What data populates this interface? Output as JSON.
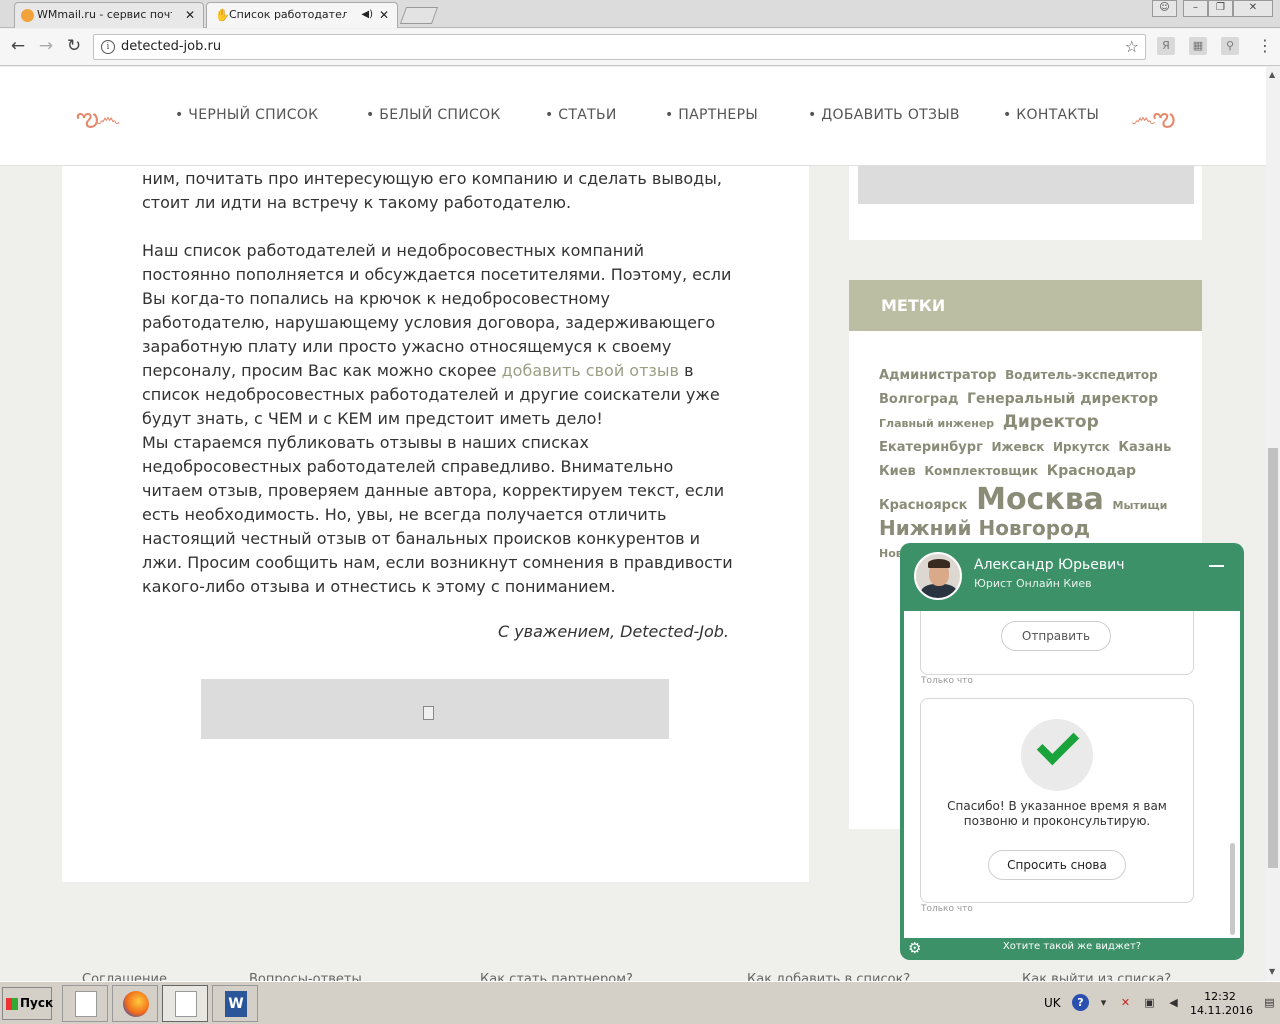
{
  "browser": {
    "tabs": [
      {
        "title": "WMmail.ru - сервис почтов",
        "active": false
      },
      {
        "title": "Список работодателей",
        "active": true
      }
    ],
    "url": "detected-job.ru"
  },
  "site": {
    "menu": [
      "• ЧЕРНЫЙ СПИСОК",
      "• БЕЛЫЙ СПИСОК",
      "• СТАТЬИ",
      "• ПАРТНЕРЫ",
      "• ДОБАВИТЬ ОТЗЫВ",
      "• КОНТАКТЫ"
    ],
    "article": {
      "p1": "ним, почитать про интересующую его компанию и сделать выводы, стоит ли идти на встречу к такому работодателю.",
      "p2_before": "Наш список работодателей и недобросовестных компаний постоянно пополняется и обсуждается посетителями. Поэтому, если Вы когда-то попались на крючок к недобросовестному работодателю, нарушающему условия договора, задерживающего заработную плату или просто ужасно относящемуся к своему персоналу, просим Вас как можно скорее ",
      "p2_link": "добавить свой отзыв",
      "p2_after": " в список недобросовестных работодателей и другие соискатели уже будут знать, с ЧЕМ и с КЕМ им предстоит иметь дело!",
      "p3": "Мы стараемся публиковать отзывы в наших списках недобросовестных работодателей справедливо. Внимательно читаем отзыв, проверяем данные автора, корректируем текст, если есть необходимость. Но, увы, не всегда получается отличить настоящий честный отзыв от банальных происков конкурентов и лжи. Просим сообщить нам, если возникнут сомнения в правдивости какого-либо отзыва и отнестись к этому с пониманием.",
      "signature": "С уважением, Detected-Job."
    },
    "tags_title": "МЕТКИ",
    "tags": [
      {
        "text": "Администратор",
        "size": 13
      },
      {
        "text": "Водитель-экспедитор",
        "size": 12
      },
      {
        "text": "Волгоград",
        "size": 13
      },
      {
        "text": "Генеральный директор",
        "size": 14
      },
      {
        "text": "Главный инженер",
        "size": 11
      },
      {
        "text": "Директор",
        "size": 17
      },
      {
        "text": "Екатеринбург",
        "size": 13
      },
      {
        "text": "Ижевск",
        "size": 12
      },
      {
        "text": "Иркутск",
        "size": 12
      },
      {
        "text": "Казань",
        "size": 13
      },
      {
        "text": "Киев",
        "size": 13
      },
      {
        "text": "Комплектовщик",
        "size": 12
      },
      {
        "text": "Краснодар",
        "size": 14
      },
      {
        "text": "Красноярск",
        "size": 13
      },
      {
        "text": "Москва",
        "size": 30
      },
      {
        "text": "Мытищи",
        "size": 11
      },
      {
        "text": "Нижний Новгород",
        "size": 20
      },
      {
        "text": "Новокузнецк",
        "size": 11
      }
    ],
    "footer_links": [
      "Соглашение",
      "Вопросы-ответы",
      "Как стать партнером?",
      "Как добавить в список?",
      "Как выйти из списка?"
    ]
  },
  "chat": {
    "agent_name": "Александр Юрьевич",
    "agent_role": "Юрист Онлайн Киев",
    "send_button": "Отправить",
    "time_1": "Только что",
    "thanks_text": "Спасибо! В указанное время я вам позвоню и проконсультирую.",
    "ask_again_button": "Спросить снова",
    "time_2": "Только что",
    "want_widget": "Хотите такой же виджет?"
  },
  "taskbar": {
    "start_label": "Пуск",
    "lang": "UK",
    "time": "12:32",
    "date": "14.11.2016"
  },
  "colors": {
    "tag_header": "#bbbea3",
    "chat_green": "#3c9169",
    "swirl": "#e58a6e",
    "link": "#9a9e83"
  }
}
